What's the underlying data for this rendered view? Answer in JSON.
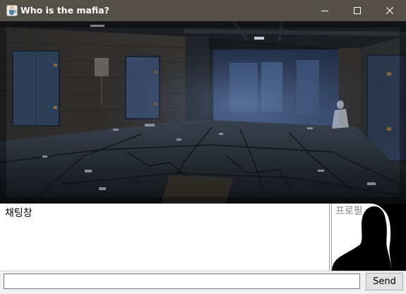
{
  "window": {
    "title": "Who is the mafia?",
    "icons": {
      "app": "java-cup-icon",
      "minimize": "minimize-icon",
      "maximize": "maximize-icon",
      "close": "close-icon"
    }
  },
  "scene": {
    "image": "dark-abandoned-corridor-scene"
  },
  "chat": {
    "label": "채팅창"
  },
  "profile": {
    "label": "프로필",
    "image": "silhouette-portrait"
  },
  "input": {
    "value": "",
    "placeholder": ""
  },
  "send": {
    "label": "Send"
  }
}
